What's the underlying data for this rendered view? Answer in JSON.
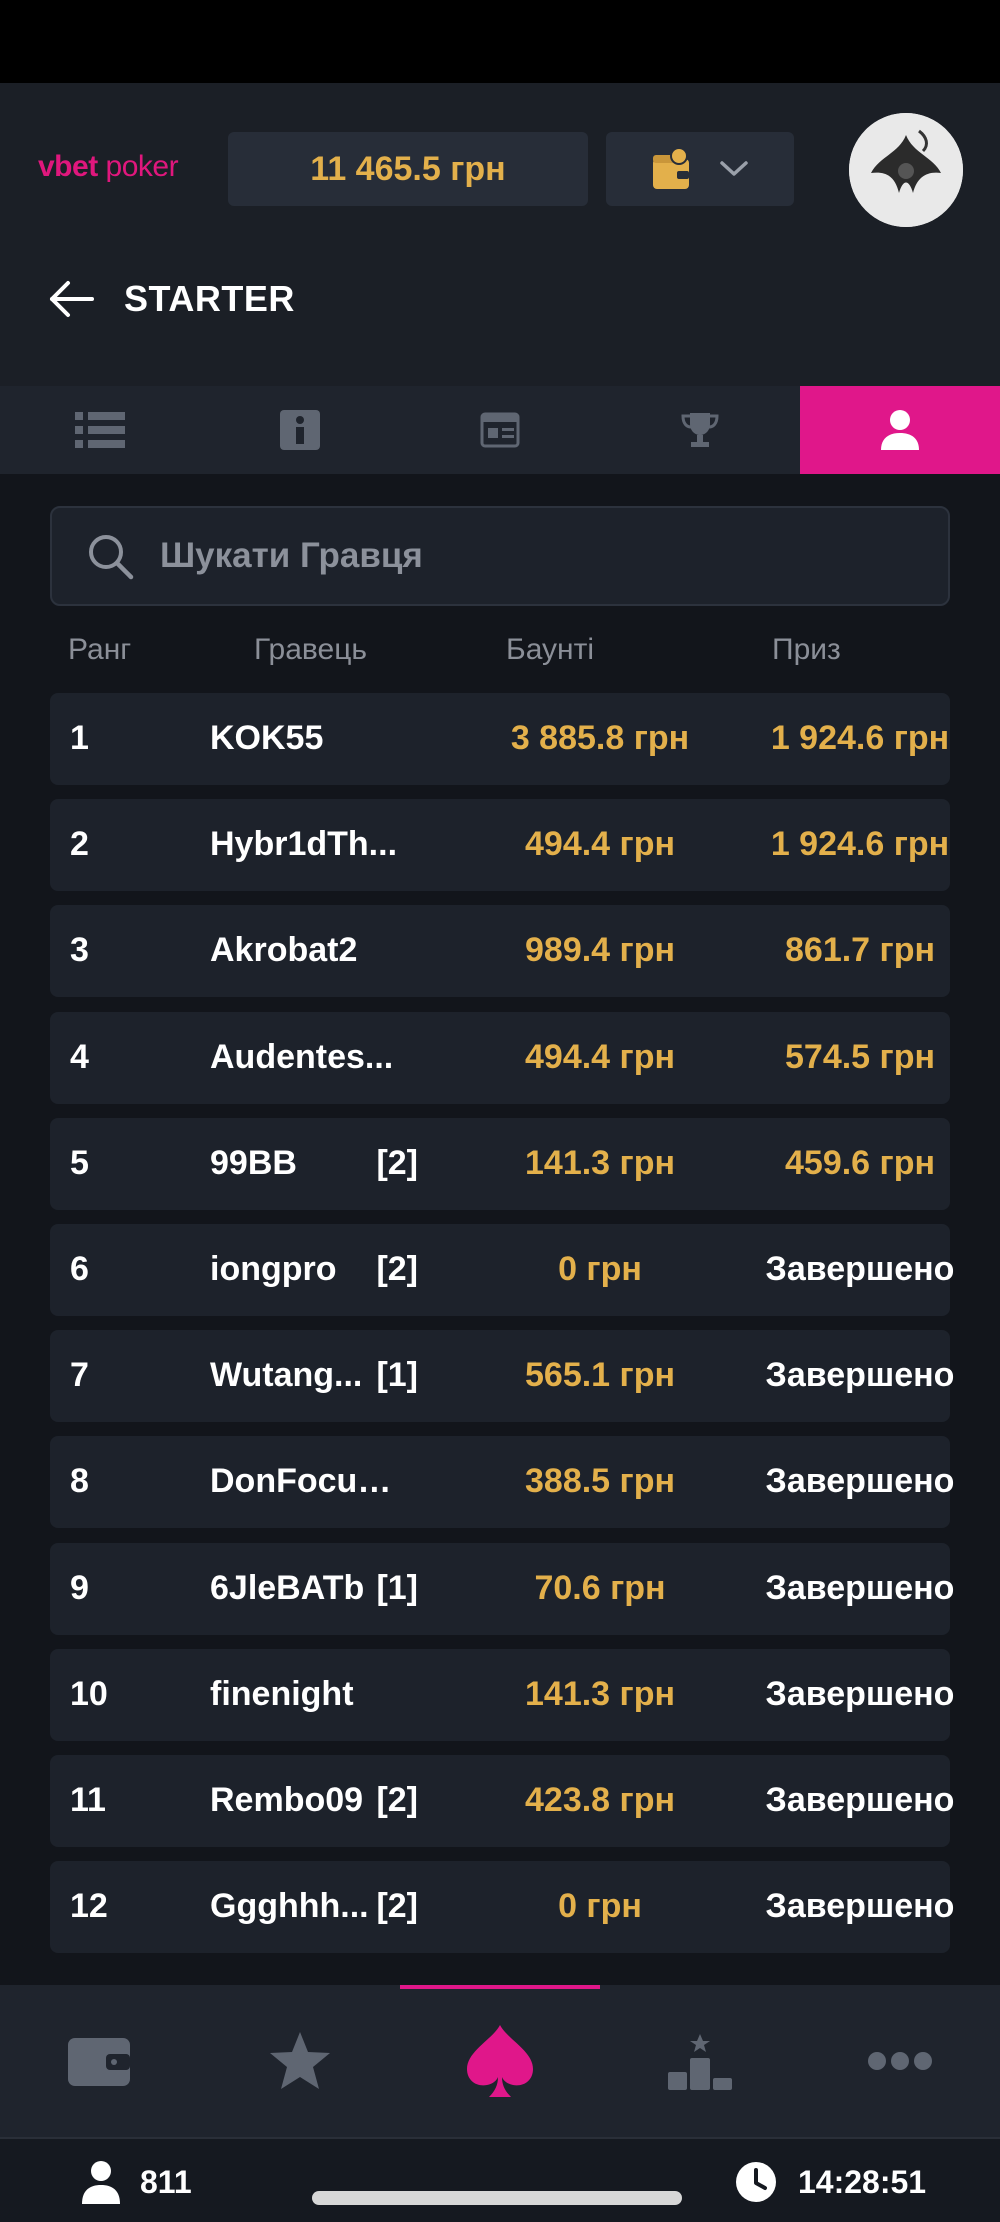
{
  "header": {
    "logo_brand": "vbet",
    "logo_sub": " poker",
    "balance": "11 465.5 грн"
  },
  "page": {
    "title": "STARTER"
  },
  "tabs": [
    {
      "name": "list-icon",
      "active": false
    },
    {
      "name": "info-icon",
      "active": false
    },
    {
      "name": "ticket-icon",
      "active": false
    },
    {
      "name": "trophy-icon",
      "active": false
    },
    {
      "name": "player-icon",
      "active": true
    }
  ],
  "search": {
    "placeholder": "Шукати Гравця",
    "value": ""
  },
  "columns": {
    "rank": "Ранг",
    "player": "Гравець",
    "bounty": "Баунті",
    "prize": "Приз"
  },
  "players": [
    {
      "rank": "1",
      "name": "KOK55",
      "reentry": "",
      "bounty": "3 885.8 грн",
      "prize": "1 924.6 грн",
      "finished": false
    },
    {
      "rank": "2",
      "name": "Hybr1dTh...",
      "reentry": "",
      "bounty": "494.4 грн",
      "prize": "1 924.6 грн",
      "finished": false
    },
    {
      "rank": "3",
      "name": "Akrobat2",
      "reentry": "",
      "bounty": "989.4 грн",
      "prize": "861.7 грн",
      "finished": false
    },
    {
      "rank": "4",
      "name": "Audentes...",
      "reentry": "",
      "bounty": "494.4 грн",
      "prize": "574.5 грн",
      "finished": false
    },
    {
      "rank": "5",
      "name": "99BB",
      "reentry": "[2]",
      "bounty": "141.3 грн",
      "prize": "459.6 грн",
      "finished": false
    },
    {
      "rank": "6",
      "name": "iongpro",
      "reentry": "[2]",
      "bounty": "0 грн",
      "prize": "Завершено",
      "finished": true
    },
    {
      "rank": "7",
      "name": "Wutang...",
      "reentry": "[1]",
      "bounty": "565.1 грн",
      "prize": "Завершено",
      "finished": true
    },
    {
      "rank": "8",
      "name": "DonFocuS...",
      "reentry": "",
      "bounty": "388.5 грн",
      "prize": "Завершено",
      "finished": true
    },
    {
      "rank": "9",
      "name": "6JleBATb",
      "reentry": "[1]",
      "bounty": "70.6 грн",
      "prize": "Завершено",
      "finished": true
    },
    {
      "rank": "10",
      "name": "finenight",
      "reentry": "",
      "bounty": "141.3 грн",
      "prize": "Завершено",
      "finished": true
    },
    {
      "rank": "11",
      "name": "Rembo09",
      "reentry": "[2]",
      "bounty": "423.8 грн",
      "prize": "Завершено",
      "finished": true
    },
    {
      "rank": "12",
      "name": "Ggghhh...",
      "reentry": "[2]",
      "bounty": "0 грн",
      "prize": "Завершено",
      "finished": true
    }
  ],
  "bottom_nav": [
    {
      "name": "wallet-icon",
      "active": false
    },
    {
      "name": "star-icon",
      "active": false
    },
    {
      "name": "spade-icon",
      "active": true
    },
    {
      "name": "leaderboard-icon",
      "active": false
    },
    {
      "name": "more-icon",
      "active": false
    }
  ],
  "footer": {
    "online_count": "811",
    "time": "14:28:51"
  },
  "colors": {
    "accent": "#e0178a",
    "gold": "#e3b04b",
    "background": "#12151b",
    "surface": "#1d222b"
  }
}
